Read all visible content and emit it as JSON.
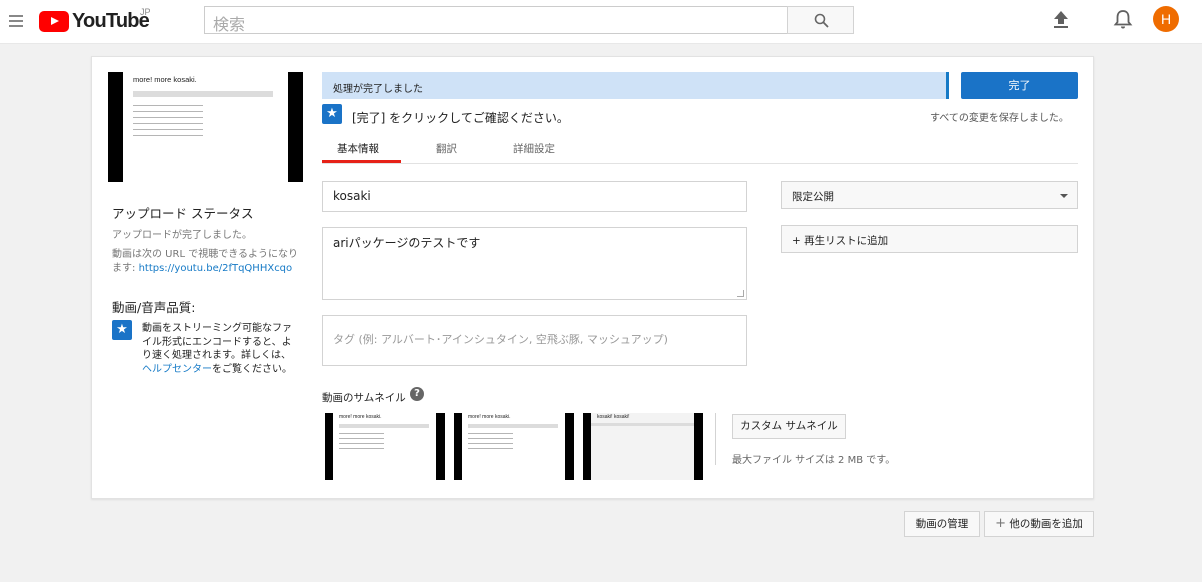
{
  "header": {
    "logo_text": "YouTube",
    "region": "JP",
    "search_placeholder": "検索",
    "avatar_letter": "H",
    "brand_color": "#ff0000",
    "avatar_color": "#ef6c00"
  },
  "left": {
    "main_thumb_title": "more! more kosaki.",
    "upload_status_title": "アップロード ステータス",
    "upload_status_text": "アップロードが完了しました。",
    "url_intro": "動画は次の URL で視聴できるようになります: ",
    "url": "https://youtu.be/2fTqQHHXcqo",
    "quality_title": "動画/音声品質:",
    "quality_text_1": "動画をストリーミング可能なファイル形式にエンコードすると、より速く処理されます。詳しくは、",
    "help_center": "ヘルプセンター",
    "quality_text_2": "をご覧ください。"
  },
  "right": {
    "progress_text": "処理が完了しました",
    "done_label": "完了",
    "confirm_text": "[完了] をクリックしてご確認ください。",
    "saved_text": "すべての変更を保存しました。",
    "tabs": [
      {
        "label": "基本情報",
        "active": true
      },
      {
        "label": "翻訳",
        "active": false
      },
      {
        "label": "詳細設定",
        "active": false
      }
    ],
    "title_value": "kosaki",
    "description_value": "ariパッケージのテストです",
    "tags_placeholder": "タグ (例: アルバート･アインシュタイン, 空飛ぶ豚, マッシュアップ)",
    "privacy_value": "限定公開",
    "playlist_label": "+ 再生リストに追加",
    "thumbnails_title": "動画のサムネイル",
    "thumb_titles": [
      "more! more kosaki.",
      "more! more kosaki.",
      "kosaki! kosaki!"
    ],
    "custom_thumbnail_label": "カスタム サムネイル",
    "max_size_text": "最大ファイル サイズは 2 MB です。",
    "accent_color": "#1a73c7",
    "tab_active_color": "#e62117"
  },
  "bottom": {
    "manage_label": "動画の管理",
    "add_more_label": "他の動画を追加"
  }
}
